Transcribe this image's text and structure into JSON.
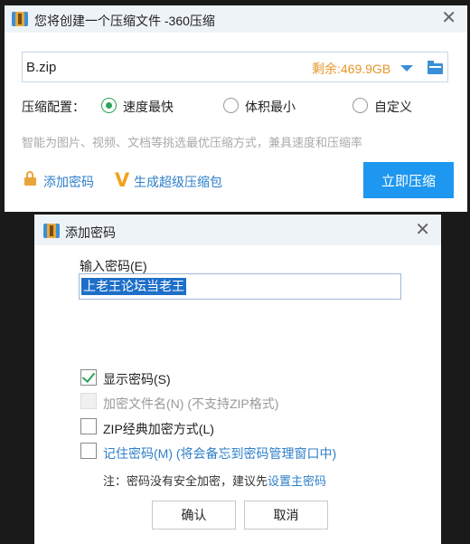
{
  "compress_dialog": {
    "title": "您将创建一个压缩文件 -360压缩",
    "filename": "B.zip",
    "free_space": "剩余:469.9GB",
    "config_label": "压缩配置：",
    "options": [
      "速度最快",
      "体积最小",
      "自定义"
    ],
    "selected_option": "速度最快",
    "hint": "智能为图片、视频、文档等挑选最优压缩方式，兼具速度和压缩率",
    "add_password": "添加密码",
    "super_package": "生成超级压缩包",
    "compress_now": "立即压缩"
  },
  "password_dialog": {
    "title": "添加密码",
    "input_label": "输入密码(E)",
    "password_value": "上老王论坛当老王",
    "checkboxes": [
      {
        "label": "显示密码(S)",
        "checked": true,
        "enabled": true
      },
      {
        "label": "加密文件名(N)  (不支持ZIP格式)",
        "checked": false,
        "enabled": false
      },
      {
        "label": "ZIP经典加密方式(L)",
        "checked": false,
        "enabled": true
      },
      {
        "label": "记住密码(M) (将会备忘到密码管理窗口中)",
        "checked": false,
        "enabled": true
      }
    ],
    "note_prefix": "注：密码没有安全加密，建议先",
    "note_link": "设置主密码",
    "ok_label": "确认",
    "cancel_label": "取消"
  },
  "colors": {
    "accent": "#1d97ef",
    "link": "#2e7fc9",
    "free_space": "#e7962a",
    "checked": "#2aa35a"
  }
}
